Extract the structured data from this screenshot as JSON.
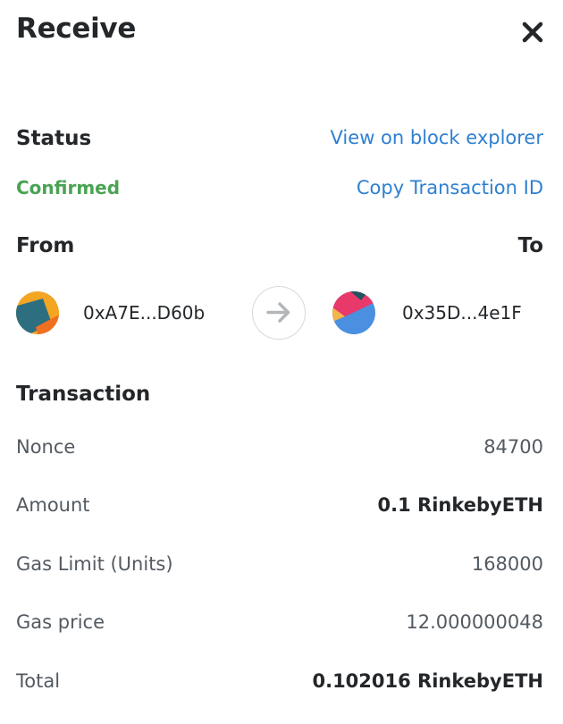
{
  "header": {
    "title": "Receive",
    "close_icon": "close-icon"
  },
  "status": {
    "label": "Status",
    "value": "Confirmed",
    "value_color": "#4aa353",
    "block_explorer_link": "View on block explorer",
    "copy_tx_link": "Copy Transaction ID"
  },
  "from_to": {
    "from_label": "From",
    "to_label": "To",
    "from_address": "0xA7E...D60b",
    "to_address": "0x35D...4e1F",
    "arrow_icon": "arrow-right-icon"
  },
  "transaction": {
    "heading": "Transaction",
    "rows": [
      {
        "label": "Nonce",
        "value": "84700"
      },
      {
        "label": "Amount",
        "value": "0.1 RinkebyETH"
      },
      {
        "label": "Gas Limit (Units)",
        "value": "168000"
      },
      {
        "label": "Gas price",
        "value": "12.000000048"
      },
      {
        "label": "Total",
        "value": "0.102016 RinkebyETH"
      }
    ]
  },
  "colors": {
    "link": "#2f80d1",
    "confirmed": "#4aa353",
    "text": "#24272a",
    "muted": "#535a61"
  }
}
